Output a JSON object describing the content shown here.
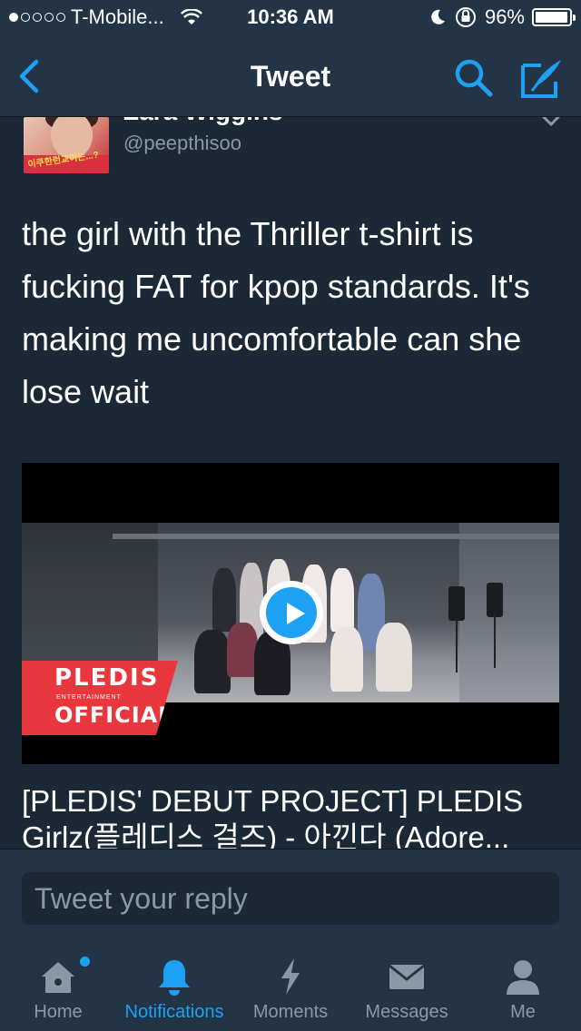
{
  "status_bar": {
    "carrier": "T-Mobile...",
    "time": "10:36 AM",
    "battery_percent": "96%",
    "battery_level": 0.96,
    "signal_bars": 1,
    "signal_total": 5
  },
  "nav": {
    "title": "Tweet",
    "back_icon": "chevron-left-icon",
    "search_icon": "search-icon",
    "compose_icon": "compose-tweet-icon",
    "accent": "#1da1f2"
  },
  "tweet": {
    "username": "Zara Wiggins",
    "handle": "@peepthisoo",
    "avatar_caption": "이쿠한런교이는...?",
    "text": "the girl with the Thriller t-shirt is fucking FAT for kpop standards. It's making me uncomfortable can she lose wait",
    "media": {
      "logo_line1": "PLEDIS",
      "logo_line2": "ENTERTAINMENT",
      "logo_line3": "OFFICIAL",
      "title": "[PLEDIS' DEBUT PROJECT] PLEDIS Girlz(플레디스 걸즈) - 아낀다 (Adore..."
    }
  },
  "reply": {
    "placeholder": "Tweet your reply"
  },
  "tabs": [
    {
      "label": "Home",
      "icon": "home-icon",
      "active": false,
      "badge": true
    },
    {
      "label": "Notifications",
      "icon": "bell-icon",
      "active": true,
      "badge": false
    },
    {
      "label": "Moments",
      "icon": "lightning-icon",
      "active": false,
      "badge": false
    },
    {
      "label": "Messages",
      "icon": "envelope-icon",
      "active": false,
      "badge": false
    },
    {
      "label": "Me",
      "icon": "person-icon",
      "active": false,
      "badge": false
    }
  ],
  "colors": {
    "background": "#1b2836",
    "bar": "#243447",
    "muted": "#8899a6",
    "accent": "#1da1f2"
  }
}
